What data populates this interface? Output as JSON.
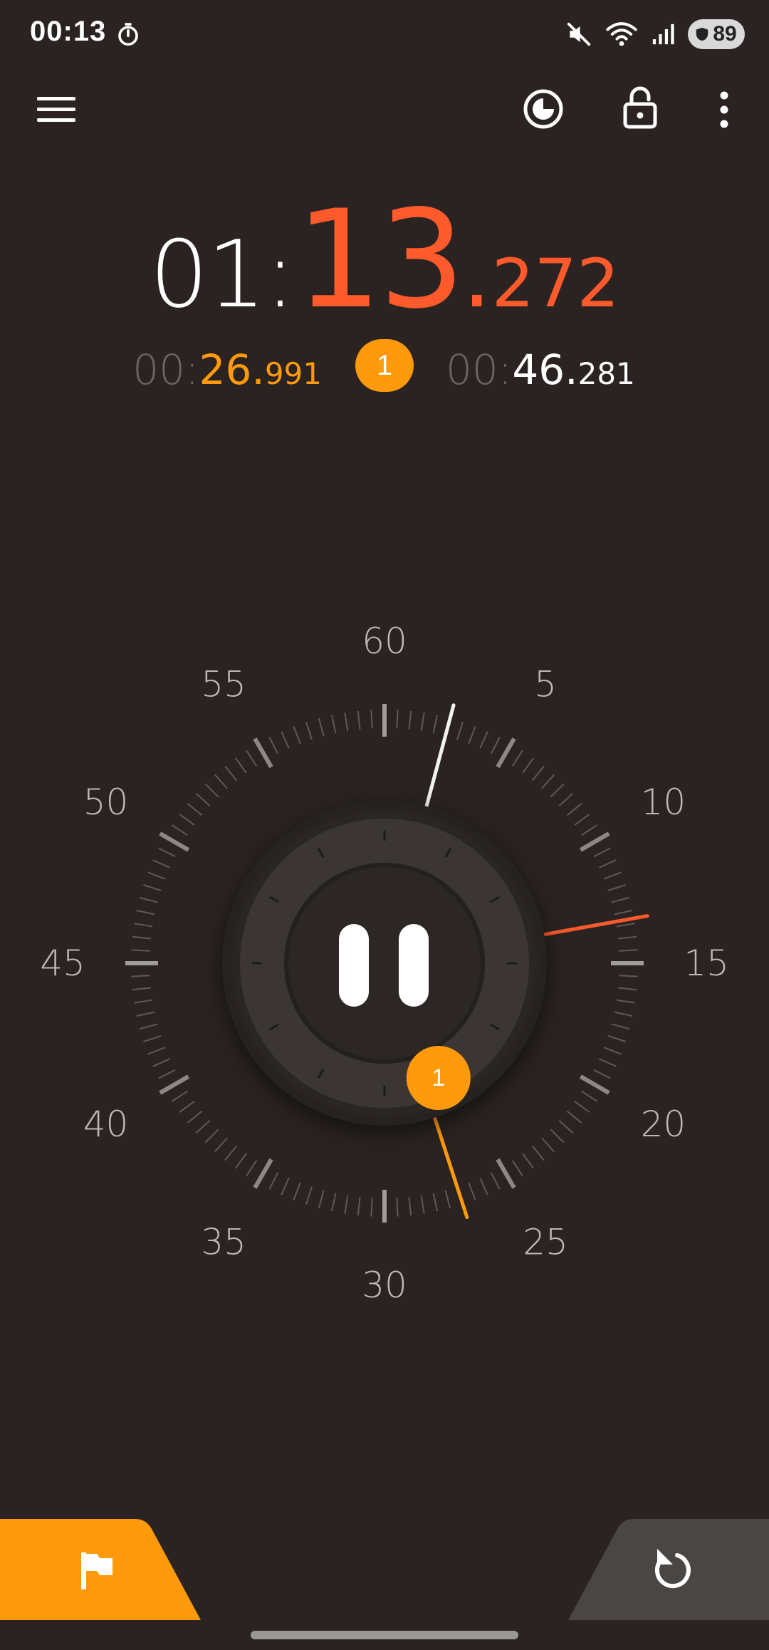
{
  "status_bar": {
    "time": "00:13",
    "battery": "89",
    "icons": [
      "stopwatch-icon",
      "mute-icon",
      "wifi-icon",
      "signal-icon",
      "battery-icon"
    ]
  },
  "toolbar": {
    "icons": [
      "menu-icon",
      "theme-icon",
      "lock-icon",
      "more-icon"
    ]
  },
  "main_time": {
    "minutes": "01",
    "colon": ":",
    "seconds": "13",
    "dot": ".",
    "millis": "272"
  },
  "lap": {
    "left_prefix": "00:",
    "left_seconds": "26.",
    "left_millis": "991",
    "badge": "1",
    "right_prefix": "00:",
    "right_seconds": "46.",
    "right_millis": "281"
  },
  "dial": {
    "labels": [
      "60",
      "5",
      "10",
      "15",
      "20",
      "25",
      "30",
      "35",
      "40",
      "45",
      "50",
      "55"
    ],
    "lap_marker": "1",
    "white_hand_seconds": 2.5,
    "orange_hand_seconds": 13.3,
    "lap_hand_seconds": 27.0
  },
  "colors": {
    "background": "#2a2321",
    "accent_red": "#ff5a2c",
    "accent_orange": "#ff9a0c"
  },
  "buttons": {
    "lap_icon": "flag-icon",
    "reset_icon": "reset-icon"
  }
}
